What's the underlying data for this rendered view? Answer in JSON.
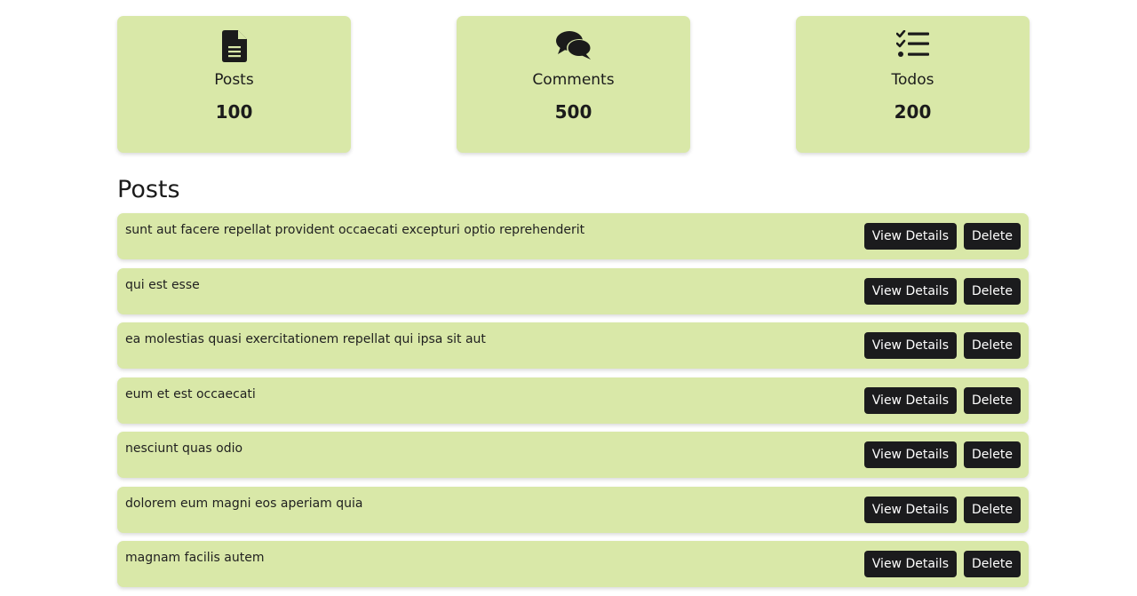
{
  "stats": [
    {
      "icon": "file-text-icon",
      "label": "Posts",
      "value": "100"
    },
    {
      "icon": "comments-icon",
      "label": "Comments",
      "value": "500"
    },
    {
      "icon": "checklist-icon",
      "label": "Todos",
      "value": "200"
    }
  ],
  "posts_section": {
    "title": "Posts",
    "view_label": "View Details",
    "delete_label": "Delete",
    "items": [
      {
        "title": "sunt aut facere repellat provident occaecati excepturi optio reprehenderit"
      },
      {
        "title": "qui est esse"
      },
      {
        "title": "ea molestias quasi exercitationem repellat qui ipsa sit aut"
      },
      {
        "title": "eum et est occaecati"
      },
      {
        "title": "nesciunt quas odio"
      },
      {
        "title": "dolorem eum magni eos aperiam quia"
      },
      {
        "title": "magnam facilis autem"
      }
    ]
  },
  "colors": {
    "card_bg": "#d9e8a8",
    "button_bg": "#1b1b1d",
    "text": "#1b1b1b"
  }
}
